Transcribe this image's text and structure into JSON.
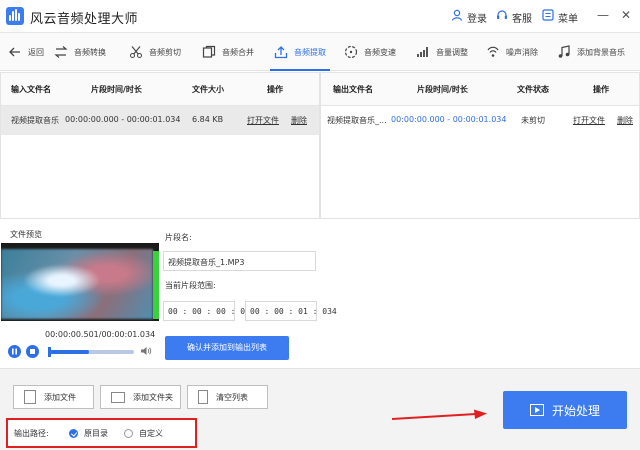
{
  "app": {
    "title": "风云音频处理大师"
  },
  "titlebar": {
    "login": "登录",
    "service": "客服",
    "menu": "菜单"
  },
  "toolbar": {
    "back": "返回",
    "items": [
      "音频转换",
      "音频剪切",
      "音频合并",
      "音频提取",
      "音频变速",
      "音量调整",
      "噪声消除",
      "添加背景音乐"
    ],
    "active_index": 3
  },
  "input_table": {
    "headers": [
      "输入文件名",
      "片段时间/时长",
      "文件大小",
      "操作"
    ],
    "rows": [
      {
        "name": "视频提取音乐",
        "time": "00:00:00.000 - 00:00:01.034",
        "size": "6.84 KB",
        "open": "打开文件",
        "delete": "删除"
      }
    ]
  },
  "output_table": {
    "headers": [
      "输出文件名",
      "片段时间/时长",
      "文件状态",
      "操作"
    ],
    "rows": [
      {
        "name": "视频提取音乐_...",
        "time": "00:00:00.000 - 00:00:01.034",
        "status": "未剪切",
        "open": "打开文件",
        "delete": "删除"
      }
    ]
  },
  "preview": {
    "label": "文件预览",
    "time": "00:00:00.501/00:00:01.034",
    "progress": 0.48
  },
  "segment": {
    "name_label": "片段名:",
    "name_value": "视频提取音乐_1.MP3",
    "range_label": "当前片段范围:",
    "start": "00 : 00 : 00 : 000",
    "end": "00 : 00 : 01 : 034",
    "confirm": "确认并添加到输出列表"
  },
  "bottom": {
    "add_file": "添加文件",
    "add_folder": "添加文件夹",
    "clear_list": "清空列表",
    "output_path_label": "输出路径:",
    "option_original": "原目录",
    "option_custom": "自定义",
    "start": "开始处理"
  },
  "colors": {
    "accent": "#3d7cf0",
    "highlight_box": "#e02020",
    "arrow": "#e02020"
  }
}
